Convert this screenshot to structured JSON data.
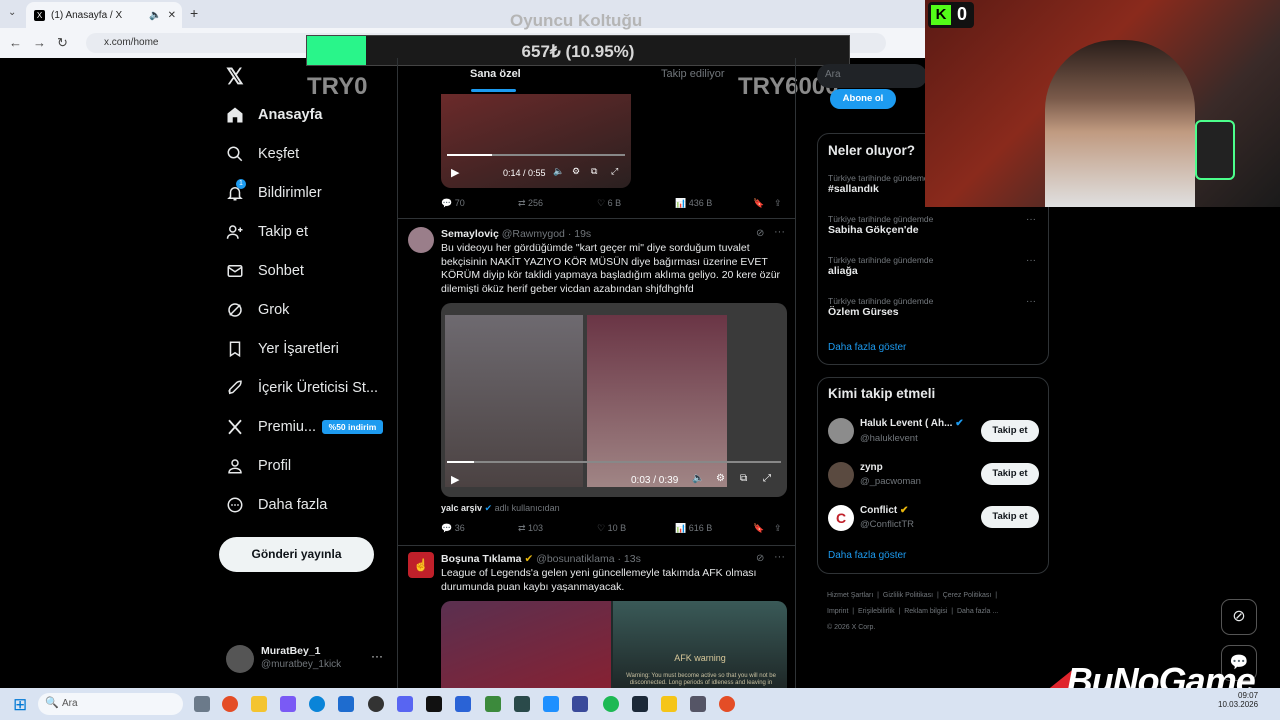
{
  "browser": {
    "tab_title": "(1) Anasayfa / X",
    "url": "x.com/home"
  },
  "overlay": {
    "title": "Oyuncu Koltuğu",
    "amount": "657₺ (10.95%)",
    "progress_fraction": 0.1095,
    "min_label": "TRY0",
    "max_label": "TRY6000",
    "kick_count": "0",
    "brand": "BuNoGame"
  },
  "nav": {
    "items": [
      {
        "label": "Anasayfa",
        "icon": "home-icon"
      },
      {
        "label": "Keşfet",
        "icon": "search-icon"
      },
      {
        "label": "Bildirimler",
        "icon": "bell-icon",
        "badge": "1"
      },
      {
        "label": "Takip et",
        "icon": "add-user-icon"
      },
      {
        "label": "Sohbet",
        "icon": "mail-icon"
      },
      {
        "label": "Grok",
        "icon": "grok-icon"
      },
      {
        "label": "Yer İşaretleri",
        "icon": "bookmark-icon"
      },
      {
        "label": "İçerik Üreticisi St...",
        "icon": "rocket-icon"
      },
      {
        "label": "Premiu...",
        "icon": "x-icon",
        "badge_text": "%50 indirim"
      },
      {
        "label": "Profil",
        "icon": "person-icon"
      },
      {
        "label": "Daha fazla",
        "icon": "more-circle-icon"
      }
    ],
    "post_button": "Gönderi yayınla",
    "account": {
      "name": "MuratBey_1",
      "handle": "@muratbey_1kick"
    }
  },
  "timeline": {
    "tabs": [
      "Sana özel",
      "Takip ediliyor"
    ],
    "post0": {
      "video_time": "0:14 / 0:55",
      "replies": "70",
      "reposts": "256",
      "likes": "6 B",
      "views": "436 B"
    },
    "post1": {
      "name": "Semayloviç",
      "handle": "@Rawmygod",
      "time": "· 19s",
      "text": "Bu videoyu her gördüğümde \"kart geçer mi\" diye sorduğum tuvalet bekçisinin NAKİT YAZIYO KÖR MÜSÜN diye bağırması üzerine EVET KÖRÜM diyip kör taklidi yapmaya başladığım aklıma geliyo. 20 kere özür dilemişti öküz herif geber vicdan azabından shjfdhghfd",
      "video_time": "0:03 / 0:39",
      "source_name": "yalc arşiv",
      "source_suffix": "adlı kullanıcıdan",
      "replies": "36",
      "reposts": "103",
      "likes": "10 B",
      "views": "616 B"
    },
    "post2": {
      "name": "Boşuna Tıklama",
      "handle": "@bosunatiklama",
      "time": "· 13s",
      "text": "League of Legends'a gelen yeni güncellemeyle takımda AFK olması durumunda puan kaybı yaşanmayacak.",
      "media_title": "AFK warning",
      "media_caption": "Warning: You must become active so that you will not be disconnected. Long periods of idleness and leaving in"
    }
  },
  "right": {
    "search_placeholder": "Ara",
    "subscribe_button": "Abone ol",
    "trends_title": "Neler oluyor?",
    "trends": [
      {
        "category": "Türkiye tarihinde gündemde",
        "name": "#sallandık"
      },
      {
        "category": "Türkiye tarihinde gündemde",
        "name": "Sabiha Gökçen'de"
      },
      {
        "category": "Türkiye tarihinde gündemde",
        "name": "aliağa"
      },
      {
        "category": "Türkiye tarihinde gündemde",
        "name": "Özlem Gürses"
      }
    ],
    "trends_more": "Daha fazla göster",
    "follow_title": "Kimi takip etmeli",
    "suggestions": [
      {
        "name": "Haluk Levent ( Ah...",
        "handle": "@haluklevent",
        "button": "Takip et"
      },
      {
        "name": "zynp",
        "handle": "@_pacwoman",
        "button": "Takip et"
      },
      {
        "name": "Conflict",
        "handle": "@ConflictTR",
        "button": "Takip et"
      }
    ],
    "follow_more": "Daha fazla göster",
    "footer_links": [
      "Hizmet Şartları",
      "Gizlilik Politikası",
      "Çerez Politikası",
      "Imprint",
      "Erişilebilirlik",
      "Reklam bilgisi",
      "Daha fazla ..."
    ],
    "copyright": "© 2026 X Corp."
  },
  "taskbar": {
    "search_placeholder": "Ara",
    "time": "09:07",
    "date": "10.03.2026"
  },
  "colors": {
    "accent": "#1d9bf0",
    "progress": "#29f58a",
    "kick": "#53fc18"
  }
}
